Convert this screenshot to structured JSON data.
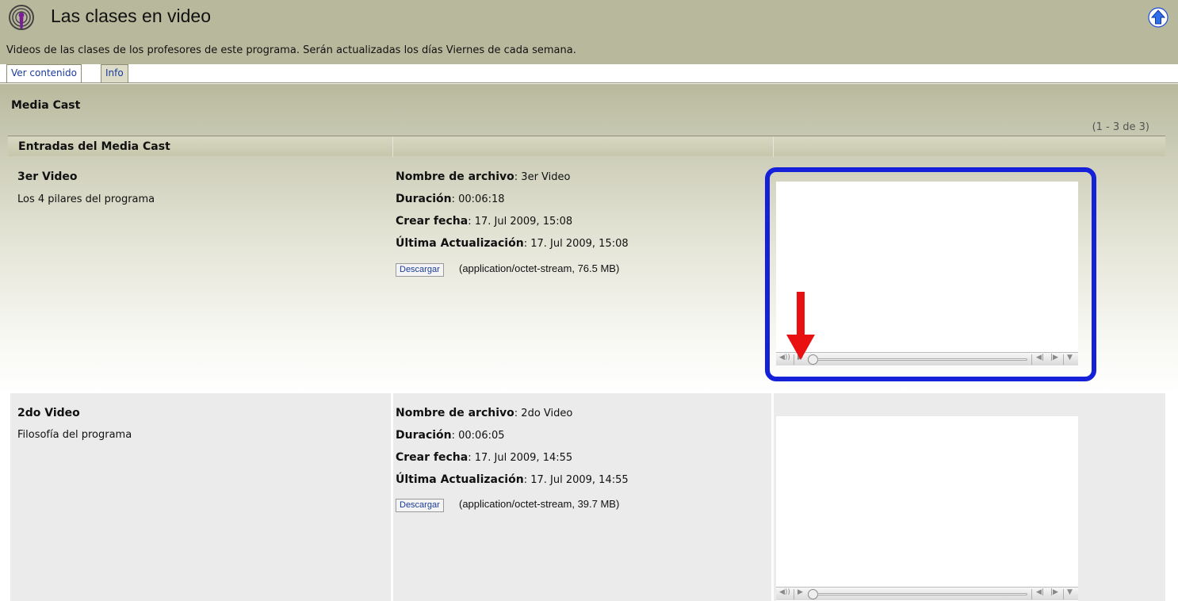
{
  "header": {
    "title": "Las clases en video",
    "description": "Videos de las clases de los profesores de este programa. Serán actualizadas los días Viernes de cada semana.",
    "podcast_icon": "podcast-icon",
    "up_icon": "arrow-up-icon"
  },
  "tabs": [
    {
      "label": "Ver contenido",
      "active": true
    },
    {
      "label": "Info",
      "active": false
    }
  ],
  "section": {
    "title": "Media Cast",
    "pagination": "(1 - 3 de 3)",
    "table_header": "Entradas del Media Cast"
  },
  "labels": {
    "filename": "Nombre de archivo",
    "duration": "Duración",
    "created": "Crear fecha",
    "updated": "Última Actualización",
    "download": "Descargar"
  },
  "entries": [
    {
      "title": "3er Video",
      "description": "Los 4 pilares del programa",
      "filename": ": 3er Video",
      "duration": ": 00:06:18",
      "created": ": 17. Jul 2009, 15:08",
      "updated": ": 17. Jul 2009, 15:08",
      "file_info": "(application/octet-stream, 76.5 MB)"
    },
    {
      "title": "2do Video",
      "description": "Filosofía del programa",
      "filename": ": 2do Video",
      "duration": ": 00:06:05",
      "created": ": 17. Jul 2009, 14:55",
      "updated": ": 17. Jul 2009, 14:55",
      "file_info": "(application/octet-stream, 39.7 MB)"
    }
  ],
  "colors": {
    "header_bg": "#b8b99c",
    "highlight": "#1521d8",
    "arrow": "#e81010",
    "link": "#1a3c9a"
  }
}
